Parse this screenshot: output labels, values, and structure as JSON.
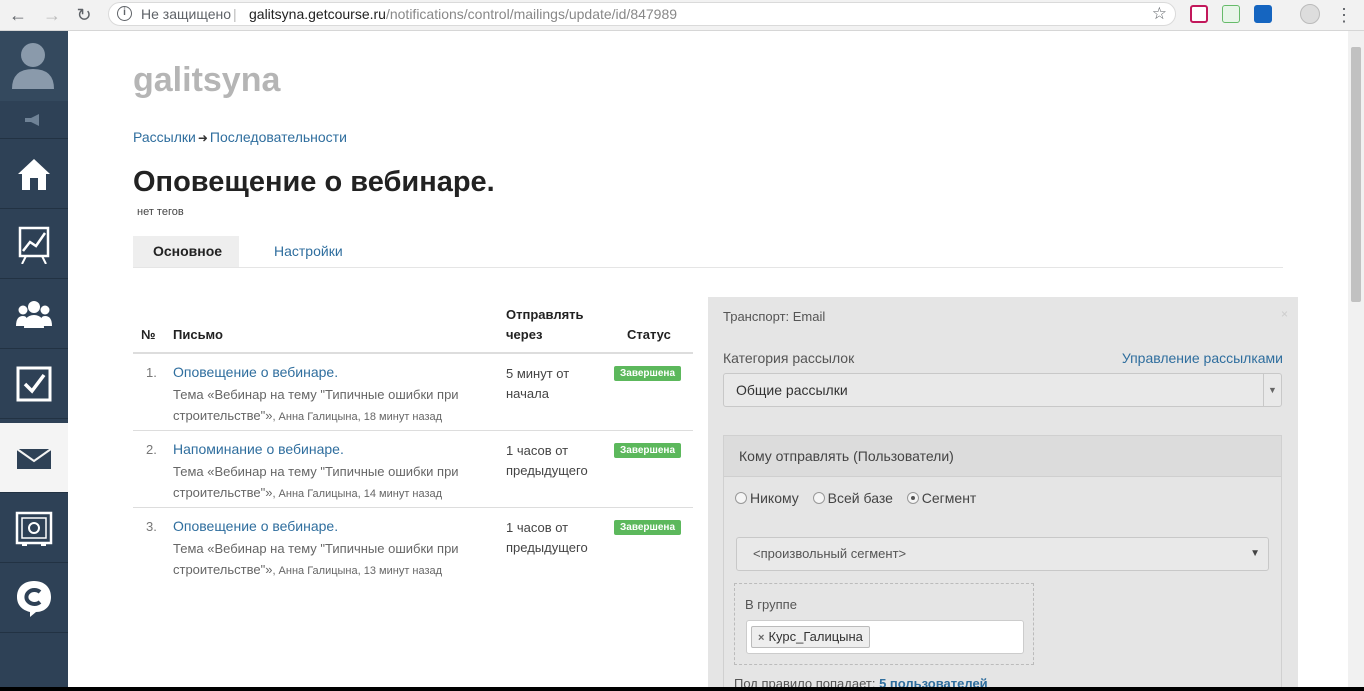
{
  "browser": {
    "security": "Не защищено",
    "url_host": "galitsyna.getcourse.ru",
    "url_path": "/notifications/control/mailings/update/id/847989"
  },
  "site_name": "galitsyna",
  "breadcrumb": {
    "item1": "Рассылки",
    "arrow": "➜",
    "item2": "Последовательности"
  },
  "page_title": "Оповещение о вебинаре.",
  "no_tags": "нет тегов",
  "tabs": [
    {
      "label": "Основное"
    },
    {
      "label": "Настройки"
    }
  ],
  "table": {
    "headers": {
      "num": "№",
      "letter": "Письмо",
      "send_after_l1": "Отправлять",
      "send_after_l2": "через",
      "status": "Статус"
    },
    "rows": [
      {
        "num": "1.",
        "title": "Оповещение о вебинаре.",
        "subject": "Тема «Вебинар на тему \"Типичные ошибки при строительстве\"»",
        "meta": ", Анна Галицына, 18 минут назад",
        "delay": "5 минут от начала",
        "status": "Завершена"
      },
      {
        "num": "2.",
        "title": "Напоминание о вебинаре.",
        "subject": "Тема «Вебинар на тему \"Типичные ошибки при строительстве\"»",
        "meta": ", Анна Галицына, 14 минут назад",
        "delay": "1 часов от предыдущего",
        "status": "Завершена"
      },
      {
        "num": "3.",
        "title": "Оповещение о вебинаре.",
        "subject": "Тема «Вебинар на тему \"Типичные ошибки при строительстве\"»",
        "meta": ", Анна Галицына, 13 минут назад",
        "delay": "1 часов от предыдущего",
        "status": "Завершена"
      }
    ]
  },
  "panel": {
    "transport": "Транспорт: Email",
    "close": "×",
    "category_label": "Категория рассылок",
    "manage_link": "Управление рассылками",
    "category_value": "Общие рассылки",
    "recipients_header": "Кому отправлять (Пользователи)",
    "radios": [
      {
        "label": "Никому"
      },
      {
        "label": "Всей базе"
      },
      {
        "label": "Сегмент"
      }
    ],
    "segment_value": "<произвольный сегмент>",
    "group_label": "В группе",
    "group_tag": "Курс_Галицына",
    "rule_text": "Под правило попадает:",
    "rule_link": "5 пользователей"
  },
  "colors": {
    "sidebar": "#2e4156",
    "link": "#2f6e9e",
    "badge": "#5cb85c"
  }
}
